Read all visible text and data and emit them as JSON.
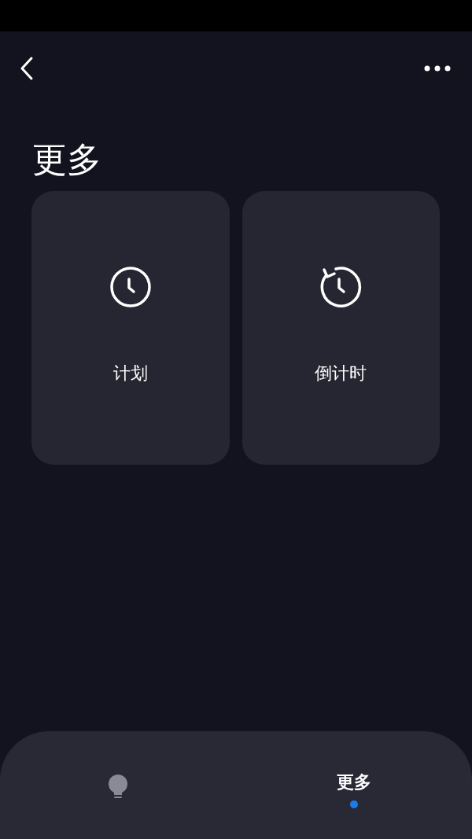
{
  "header": {
    "title": "更多"
  },
  "cards": [
    {
      "kind": "clock",
      "label": "计划"
    },
    {
      "kind": "countdown",
      "label": "倒计时"
    }
  ],
  "tab_bar": [
    {
      "kind": "icon",
      "selected": false
    },
    {
      "kind": "text",
      "label": "更多",
      "selected": true
    }
  ]
}
